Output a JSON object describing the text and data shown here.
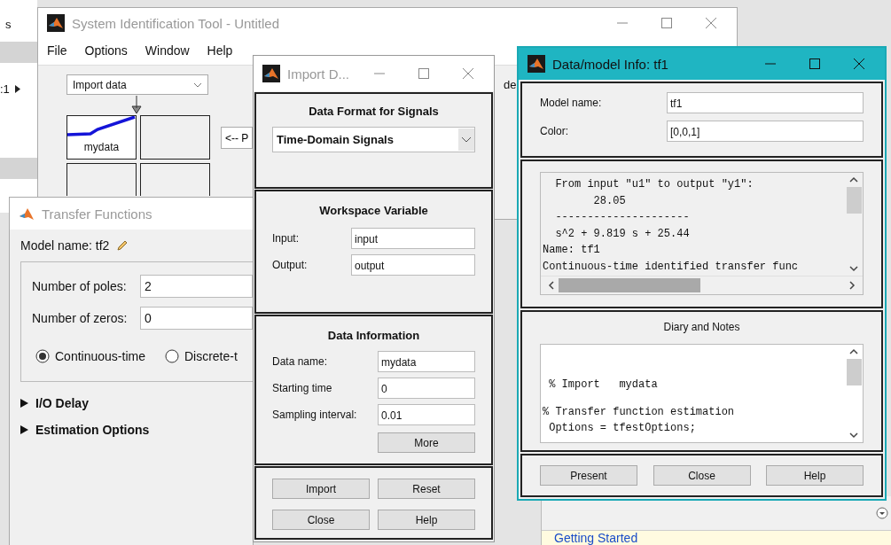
{
  "background": {
    "left_texts": [
      "s",
      ":1"
    ],
    "link": "Getting Started"
  },
  "main_window": {
    "title": "System Identification Tool - Untitled",
    "menu": [
      "File",
      "Options",
      "Window",
      "Help"
    ],
    "import_dropdown": "Import data",
    "side_text": "de",
    "data_slots": [
      {
        "label": "mydata",
        "kind": "data"
      },
      {
        "kind": "empty"
      },
      {
        "kind": "empty"
      },
      {
        "kind": "empty"
      }
    ],
    "side_button": "<-- P"
  },
  "transfer_window": {
    "title": "Transfer Functions",
    "model_name": "Model name: tf2",
    "fields": [
      {
        "label": "Number of poles:",
        "value": "2"
      },
      {
        "label": "Number of zeros:",
        "value": "0"
      }
    ],
    "time_options": [
      {
        "label": "Continuous-time",
        "selected": true
      },
      {
        "label": "Discrete-t",
        "selected": false
      }
    ],
    "sections": [
      {
        "label": "I/O Delay",
        "expanded": false
      },
      {
        "label": "Estimation Options",
        "expanded": false
      }
    ]
  },
  "import_window": {
    "title": "Import D...",
    "format_heading": "Data Format for Signals",
    "format": "Time-Domain Signals",
    "workspace_heading": "Workspace Variable",
    "workspace_fields": [
      {
        "label": "Input:",
        "value": "input"
      },
      {
        "label": "Output:",
        "value": "output"
      }
    ],
    "info_heading": "Data Information",
    "info_fields": [
      {
        "label": "Data name:",
        "value": "mydata"
      },
      {
        "label": "Starting time",
        "value": "0"
      },
      {
        "label": "Sampling interval:",
        "value": "0.01"
      }
    ],
    "more": "More",
    "buttons": [
      "Import",
      "Reset",
      "Close",
      "Help"
    ]
  },
  "info_window": {
    "title": "Data/model Info: tf1",
    "fields": [
      {
        "label": "Model name:",
        "value": "tf1"
      },
      {
        "label": "Color:",
        "value": "[0,0,1]"
      }
    ],
    "model_text": [
      "  From input \"u1\" to output \"y1\":",
      "        28.05",
      "  ---------------------",
      "  s^2 + 9.819 s + 25.44",
      "Name: tf1",
      "Continuous-time identified transfer func"
    ],
    "notes_heading": "Diary and Notes",
    "notes_text": [
      " % Import   mydata",
      "% Transfer function estimation",
      " Options = tfestOptions;"
    ],
    "buttons": [
      "Present",
      "Close",
      "Help"
    ]
  }
}
